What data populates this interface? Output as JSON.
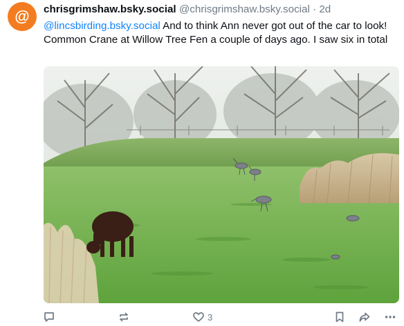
{
  "post": {
    "avatar_glyph": "@",
    "display_name": "chrisgrimshaw.bsky.social",
    "handle": "@chrisgrimshaw.bsky.social",
    "separator": " · ",
    "timestamp": "2d",
    "mention": "@lincsbirding.bsky.social",
    "text": " And to think Ann never got out of the car to look! Common Crane at Willow Tree Fen a couple of days ago. I saw six in total",
    "like_count": "3"
  },
  "icons": {
    "reply": "speech-bubble-icon",
    "repost": "repost-arrows-icon",
    "like": "heart-icon",
    "bookmark": "bookmark-icon",
    "share": "share-arrow-icon",
    "more": "ellipsis-icon"
  },
  "colors": {
    "avatar": "#f47c20",
    "mention": "#1083fe",
    "muted": "#6f7a86"
  }
}
